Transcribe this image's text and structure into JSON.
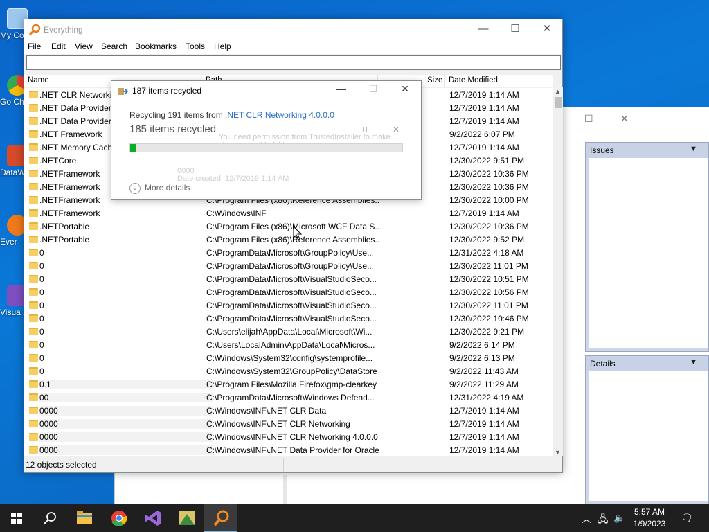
{
  "desktop": {
    "icons": [
      {
        "label": "My Co",
        "icon": "computer-icon",
        "color": "#9cc8f0"
      },
      {
        "label": "Go Ch",
        "icon": "chrome-icon",
        "color": "#e94235"
      },
      {
        "label": "DataW",
        "icon": "datawarrior-icon",
        "color": "#d64a2a"
      },
      {
        "label": "Ever",
        "icon": "everything-icon",
        "color": "#f07a1a"
      },
      {
        "label": "Visua 2",
        "icon": "visual-studio-icon",
        "color": "#7f4fc2"
      }
    ]
  },
  "background_window": {
    "controls": {
      "minimize": "—",
      "maximize": "☐",
      "close": "✕"
    },
    "panels": [
      {
        "title": "Issues"
      },
      {
        "title": "Details"
      }
    ]
  },
  "everything": {
    "title": "Everything",
    "controls": {
      "minimize": "—",
      "maximize": "☐",
      "close": "✕"
    },
    "menu": [
      "File",
      "Edit",
      "View",
      "Search",
      "Bookmarks",
      "Tools",
      "Help"
    ],
    "search_value": "",
    "columns": {
      "name": "Name",
      "path": "Path",
      "size": "Size",
      "date": "Date Modified"
    },
    "rows": [
      {
        "name": ".NET CLR Networking 4.0.0.0",
        "path": "",
        "date": "12/7/2019 1:14 AM"
      },
      {
        "name": ".NET Data Provider for Oracle",
        "path": "",
        "date": "12/7/2019 1:14 AM"
      },
      {
        "name": ".NET Data Provider for SqlServer",
        "path": "",
        "date": "12/7/2019 1:14 AM"
      },
      {
        "name": ".NET Framework",
        "path": "",
        "date": "9/2/2022 6:07 PM"
      },
      {
        "name": ".NET Memory Cache 4.0",
        "path": "",
        "date": "12/7/2019 1:14 AM"
      },
      {
        "name": ".NETCore",
        "path": "",
        "date": "12/30/2022 9:51 PM"
      },
      {
        "name": ".NETFramework",
        "path": "",
        "date": "12/30/2022 10:36 PM"
      },
      {
        "name": ".NETFramework",
        "path": "",
        "date": "12/30/2022 10:36 PM"
      },
      {
        "name": ".NETFramework",
        "path": "C:\\Program Files (x86)\\Reference Assemblies...",
        "date": "12/30/2022 10:00 PM"
      },
      {
        "name": ".NETFramework",
        "path": "C:\\Windows\\INF",
        "date": "12/7/2019 1:14 AM"
      },
      {
        "name": ".NETPortable",
        "path": "C:\\Program Files (x86)\\Microsoft WCF Data S...",
        "date": "12/30/2022 10:36 PM"
      },
      {
        "name": ".NETPortable",
        "path": "C:\\Program Files (x86)\\Reference Assemblies...",
        "date": "12/30/2022 9:52 PM"
      },
      {
        "name": "0",
        "path": "C:\\ProgramData\\Microsoft\\GroupPolicy\\Use...",
        "date": "12/31/2022 4:18 AM"
      },
      {
        "name": "0",
        "path": "C:\\ProgramData\\Microsoft\\GroupPolicy\\Use...",
        "date": "12/30/2022 11:01 PM"
      },
      {
        "name": "0",
        "path": "C:\\ProgramData\\Microsoft\\VisualStudioSeco...",
        "date": "12/30/2022 10:51 PM"
      },
      {
        "name": "0",
        "path": "C:\\ProgramData\\Microsoft\\VisualStudioSeco...",
        "date": "12/30/2022 10:56 PM"
      },
      {
        "name": "0",
        "path": "C:\\ProgramData\\Microsoft\\VisualStudioSeco...",
        "date": "12/30/2022 11:01 PM"
      },
      {
        "name": "0",
        "path": "C:\\ProgramData\\Microsoft\\VisualStudioSeco...",
        "date": "12/30/2022 10:46 PM"
      },
      {
        "name": "0",
        "path": "C:\\Users\\elijah\\AppData\\Local\\Microsoft\\Wi...",
        "date": "12/30/2022 9:21 PM"
      },
      {
        "name": "0",
        "path": "C:\\Users\\LocalAdmin\\AppData\\Local\\Micros...",
        "date": "9/2/2022 6:14 PM"
      },
      {
        "name": "0",
        "path": "C:\\Windows\\System32\\config\\systemprofile...",
        "date": "9/2/2022 6:13 PM"
      },
      {
        "name": "0",
        "path": "C:\\Windows\\System32\\GroupPolicy\\DataStore",
        "date": "9/2/2022 11:43 AM"
      },
      {
        "name": "0.1",
        "path": "C:\\Program Files\\Mozilla Firefox\\gmp-clearkey",
        "date": "9/2/2022 11:29 AM",
        "sel": true
      },
      {
        "name": "00",
        "path": "C:\\ProgramData\\Microsoft\\Windows Defend...",
        "date": "12/31/2022 4:19 AM",
        "sel": true
      },
      {
        "name": "0000",
        "path": "C:\\Windows\\INF\\.NET CLR Data",
        "date": "12/7/2019 1:14 AM",
        "sel": true
      },
      {
        "name": "0000",
        "path": "C:\\Windows\\INF\\.NET CLR Networking",
        "date": "12/7/2019 1:14 AM",
        "sel": true
      },
      {
        "name": "0000",
        "path": "C:\\Windows\\INF\\.NET CLR Networking 4.0.0.0",
        "date": "12/7/2019 1:14 AM",
        "sel": true
      },
      {
        "name": "0000",
        "path": "C:\\Windows\\INF\\.NET Data Provider for Oracle",
        "date": "12/7/2019 1:14 AM",
        "sel": true
      }
    ],
    "status": "12 objects selected"
  },
  "dialog": {
    "title": "187 items recycled",
    "controls": {
      "minimize": "—",
      "maximize": "☐",
      "close": "✕"
    },
    "line_prefix": "Recycling 191 items from ",
    "line_link": ".NET CLR Networking 4.0.0.0",
    "headline": "185 items recycled",
    "ghost_text": "You need permission from TrustedInstaller to make changes to this folder",
    "ghost_name": "0000",
    "ghost_date": "Date created: 12/7/2019 1:14 AM",
    "progress": 0.02,
    "more_details": "More details"
  },
  "taskbar": {
    "apps": [
      {
        "name": "start-button",
        "icon": "windows-logo-icon"
      },
      {
        "name": "search-button",
        "icon": "search-icon"
      },
      {
        "name": "file-explorer-button",
        "icon": "folder-icon"
      },
      {
        "name": "chrome-button",
        "icon": "chrome-icon"
      },
      {
        "name": "visual-studio-button",
        "icon": "visual-studio-icon"
      },
      {
        "name": "datawarrior-button",
        "icon": "datawarrior-icon"
      },
      {
        "name": "everything-button",
        "icon": "everything-icon",
        "active": true
      }
    ],
    "time": "5:57 AM",
    "date": "1/9/2023"
  }
}
